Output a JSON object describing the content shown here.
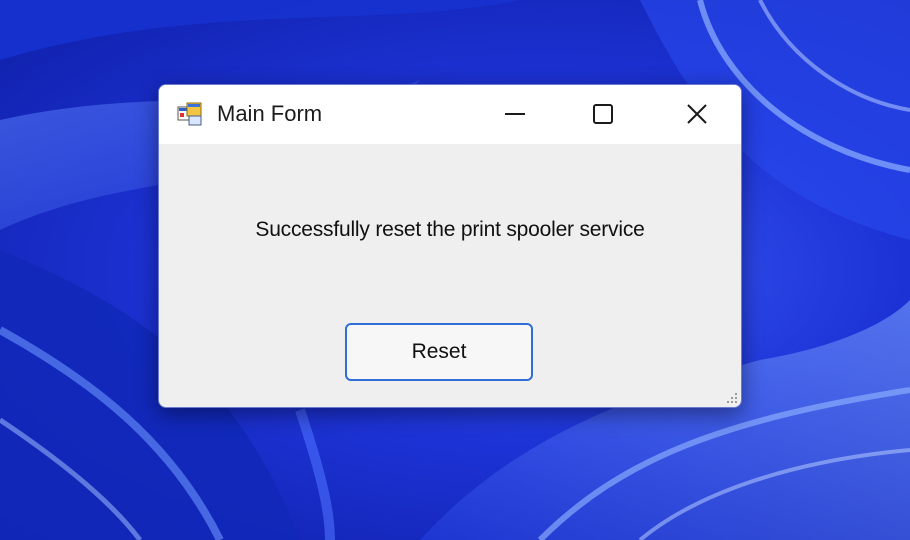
{
  "window": {
    "title": "Main Form",
    "message": "Successfully reset the print spooler service",
    "reset_label": "Reset"
  },
  "icons": {
    "app": "app-form-icon",
    "minimize": "minimize-icon",
    "maximize": "maximize-icon",
    "close": "close-icon",
    "grip": "resize-grip-icon"
  },
  "colors": {
    "desktop_blue": "#1d33d6",
    "button_border": "#2f6ed6",
    "window_body": "#efefef"
  }
}
